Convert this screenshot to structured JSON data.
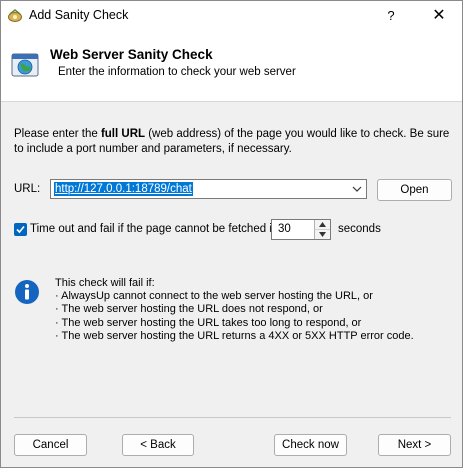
{
  "window": {
    "title": "Add Sanity Check",
    "help_glyph": "?",
    "close_glyph": "✕"
  },
  "header": {
    "title": "Web Server Sanity Check",
    "subtitle": "Enter the information to check your web server"
  },
  "intro": {
    "pre": "Please enter the ",
    "bold": "full URL",
    "post": " (web address) of the page you would like to check. Be sure to include a port number and parameters, if necessary."
  },
  "url": {
    "label": "URL:",
    "value": "http://127.0.0.1:18789/chat",
    "open_label": "Open"
  },
  "timeout": {
    "checked": true,
    "label": "Time out and fail if the page cannot be fetched in",
    "value": "30",
    "unit": "seconds"
  },
  "info": {
    "heading": "This check will fail if:",
    "items": [
      "· AlwaysUp cannot connect to the web server hosting the URL, or",
      "· The web server hosting the URL does not respond, or",
      "· The web server hosting the URL takes too long to respond, or",
      "· The web server hosting the URL returns a 4XX or 5XX HTTP error code."
    ]
  },
  "footer": {
    "cancel": "Cancel",
    "back": "< Back",
    "check_now": "Check now",
    "next": "Next >"
  },
  "colors": {
    "accent": "#0078d7",
    "checkbox": "#0067c0",
    "info_icon": "#1565c0"
  },
  "icons": {
    "title": "app-icon",
    "header": "globe-window-icon",
    "info": "info-icon"
  }
}
